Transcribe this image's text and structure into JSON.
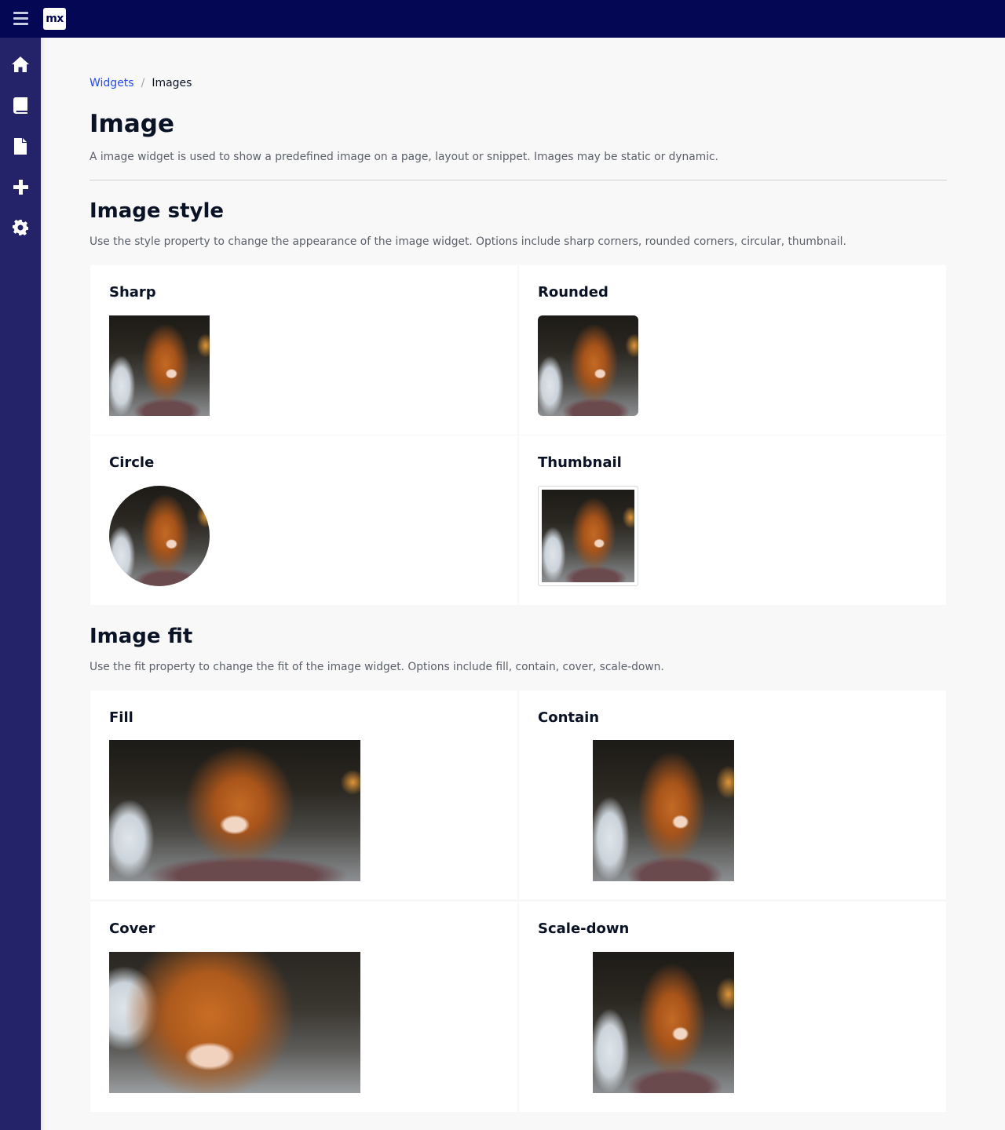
{
  "app": {
    "logo_text": "mx"
  },
  "topbar": {
    "menu_icon": "hamburger-icon"
  },
  "sidebar": {
    "items": [
      {
        "name": "home",
        "icon": "home-icon"
      },
      {
        "name": "book",
        "icon": "book-icon"
      },
      {
        "name": "document",
        "icon": "file-icon"
      },
      {
        "name": "add",
        "icon": "plus-icon"
      },
      {
        "name": "settings",
        "icon": "gear-icon"
      }
    ]
  },
  "breadcrumb": {
    "parent": "Widgets",
    "separator": "/",
    "current": "Images"
  },
  "page": {
    "title": "Image",
    "description": "A image widget is used to show a predefined image on a page, layout or snippet. Images may be static or dynamic."
  },
  "sections": {
    "style": {
      "title": "Image style",
      "description": "Use the style property to change the appearance of the image widget. Options include sharp corners, rounded corners, circular, thumbnail.",
      "cards": [
        {
          "label": "Sharp"
        },
        {
          "label": "Rounded"
        },
        {
          "label": "Circle"
        },
        {
          "label": "Thumbnail"
        }
      ]
    },
    "fit": {
      "title": "Image fit",
      "description": "Use the fit property to change the fit of the image widget. Options include fill, contain, cover, scale-down.",
      "cards": [
        {
          "label": "Fill"
        },
        {
          "label": "Contain"
        },
        {
          "label": "Cover"
        },
        {
          "label": "Scale-down"
        }
      ]
    }
  },
  "colors": {
    "topbar": "#030754",
    "sidebar": "#242369",
    "link": "#264ae5",
    "background": "#f8f8f8"
  }
}
